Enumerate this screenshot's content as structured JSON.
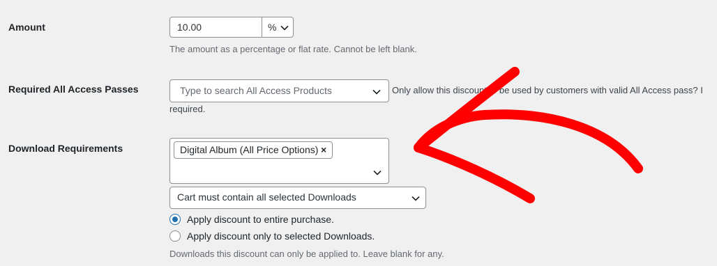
{
  "amount": {
    "label": "Amount",
    "value": "10.00",
    "unit": "%",
    "description": "The amount as a percentage or flat rate. Cannot be left blank."
  },
  "access_passes": {
    "label": "Required All Access Passes",
    "placeholder": "Type to search All Access Products",
    "description_line1": "Only allow this discount to be used by customers with valid All Access pass? I",
    "description_line2": "required."
  },
  "download_requirements": {
    "label": "Download Requirements",
    "selected_tag": "Digital Album (All Price Options)",
    "tag_remove": "×",
    "condition": "Cart must contain all selected Downloads",
    "radio_entire": "Apply discount to entire purchase.",
    "radio_selected": "Apply discount only to selected Downloads.",
    "radio_checked": "entire",
    "description": "Downloads this discount can only be applied to. Leave blank for any."
  },
  "colors": {
    "background": "#f0f0f1",
    "accent": "#2271b1",
    "annotation": "#ff0000"
  },
  "icons": [
    "chevron-down-icon",
    "close-icon",
    "red-arrow-annotation"
  ]
}
